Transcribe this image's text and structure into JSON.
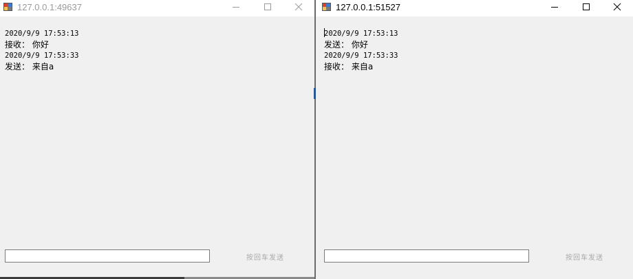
{
  "windows": [
    {
      "title": "127.0.0.1:49637",
      "active": false,
      "messages": [
        {
          "timestamp": "2020/9/9 17:53:13",
          "text": "接收： 你好"
        },
        {
          "timestamp": "2020/9/9 17:53:33",
          "text": "发送： 来自a"
        }
      ],
      "input_value": "",
      "send_hint": "按回车发送"
    },
    {
      "title": "127.0.0.1:51527",
      "active": true,
      "messages": [
        {
          "timestamp": "2020/9/9 17:53:13",
          "text": "发送： 你好"
        },
        {
          "timestamp": "2020/9/9 17:53:33",
          "text": "接收： 来自a"
        }
      ],
      "input_value": "",
      "send_hint": "按回车发送"
    }
  ],
  "icons": {
    "app": "app-icon",
    "minimize": "minimize-icon",
    "maximize": "maximize-icon",
    "close": "close-icon"
  },
  "colors": {
    "window_bg": "#f0f0f0",
    "titlebar_bg": "#ffffff",
    "inactive_title": "#9a9a9a",
    "active_title": "#000000",
    "hint_text": "#a8a8a8"
  }
}
